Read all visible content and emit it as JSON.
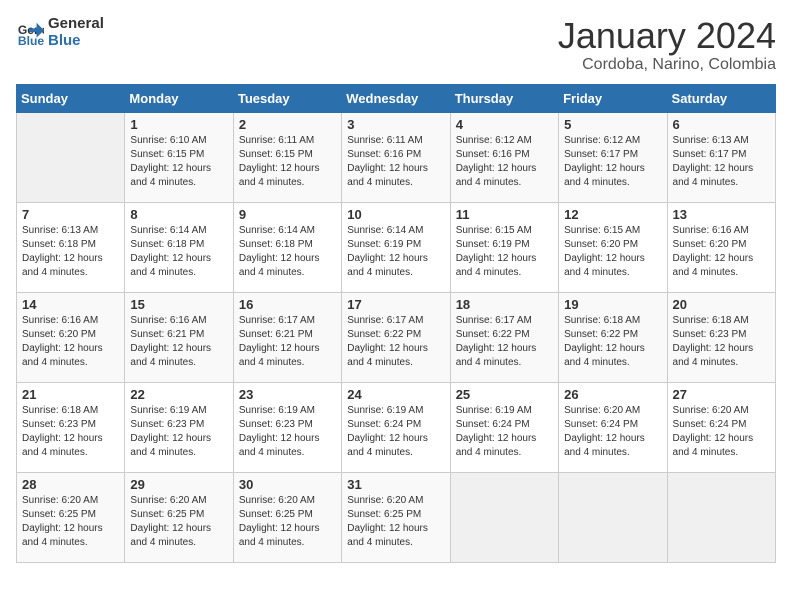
{
  "logo": {
    "line1": "General",
    "line2": "Blue"
  },
  "title": "January 2024",
  "subtitle": "Cordoba, Narino, Colombia",
  "days_header": [
    "Sunday",
    "Monday",
    "Tuesday",
    "Wednesday",
    "Thursday",
    "Friday",
    "Saturday"
  ],
  "weeks": [
    [
      {
        "day": "",
        "info": ""
      },
      {
        "day": "1",
        "info": "Sunrise: 6:10 AM\nSunset: 6:15 PM\nDaylight: 12 hours\nand 4 minutes."
      },
      {
        "day": "2",
        "info": "Sunrise: 6:11 AM\nSunset: 6:15 PM\nDaylight: 12 hours\nand 4 minutes."
      },
      {
        "day": "3",
        "info": "Sunrise: 6:11 AM\nSunset: 6:16 PM\nDaylight: 12 hours\nand 4 minutes."
      },
      {
        "day": "4",
        "info": "Sunrise: 6:12 AM\nSunset: 6:16 PM\nDaylight: 12 hours\nand 4 minutes."
      },
      {
        "day": "5",
        "info": "Sunrise: 6:12 AM\nSunset: 6:17 PM\nDaylight: 12 hours\nand 4 minutes."
      },
      {
        "day": "6",
        "info": "Sunrise: 6:13 AM\nSunset: 6:17 PM\nDaylight: 12 hours\nand 4 minutes."
      }
    ],
    [
      {
        "day": "7",
        "info": "Sunrise: 6:13 AM\nSunset: 6:18 PM\nDaylight: 12 hours\nand 4 minutes."
      },
      {
        "day": "8",
        "info": "Sunrise: 6:14 AM\nSunset: 6:18 PM\nDaylight: 12 hours\nand 4 minutes."
      },
      {
        "day": "9",
        "info": "Sunrise: 6:14 AM\nSunset: 6:18 PM\nDaylight: 12 hours\nand 4 minutes."
      },
      {
        "day": "10",
        "info": "Sunrise: 6:14 AM\nSunset: 6:19 PM\nDaylight: 12 hours\nand 4 minutes."
      },
      {
        "day": "11",
        "info": "Sunrise: 6:15 AM\nSunset: 6:19 PM\nDaylight: 12 hours\nand 4 minutes."
      },
      {
        "day": "12",
        "info": "Sunrise: 6:15 AM\nSunset: 6:20 PM\nDaylight: 12 hours\nand 4 minutes."
      },
      {
        "day": "13",
        "info": "Sunrise: 6:16 AM\nSunset: 6:20 PM\nDaylight: 12 hours\nand 4 minutes."
      }
    ],
    [
      {
        "day": "14",
        "info": "Sunrise: 6:16 AM\nSunset: 6:20 PM\nDaylight: 12 hours\nand 4 minutes."
      },
      {
        "day": "15",
        "info": "Sunrise: 6:16 AM\nSunset: 6:21 PM\nDaylight: 12 hours\nand 4 minutes."
      },
      {
        "day": "16",
        "info": "Sunrise: 6:17 AM\nSunset: 6:21 PM\nDaylight: 12 hours\nand 4 minutes."
      },
      {
        "day": "17",
        "info": "Sunrise: 6:17 AM\nSunset: 6:22 PM\nDaylight: 12 hours\nand 4 minutes."
      },
      {
        "day": "18",
        "info": "Sunrise: 6:17 AM\nSunset: 6:22 PM\nDaylight: 12 hours\nand 4 minutes."
      },
      {
        "day": "19",
        "info": "Sunrise: 6:18 AM\nSunset: 6:22 PM\nDaylight: 12 hours\nand 4 minutes."
      },
      {
        "day": "20",
        "info": "Sunrise: 6:18 AM\nSunset: 6:23 PM\nDaylight: 12 hours\nand 4 minutes."
      }
    ],
    [
      {
        "day": "21",
        "info": "Sunrise: 6:18 AM\nSunset: 6:23 PM\nDaylight: 12 hours\nand 4 minutes."
      },
      {
        "day": "22",
        "info": "Sunrise: 6:19 AM\nSunset: 6:23 PM\nDaylight: 12 hours\nand 4 minutes."
      },
      {
        "day": "23",
        "info": "Sunrise: 6:19 AM\nSunset: 6:23 PM\nDaylight: 12 hours\nand 4 minutes."
      },
      {
        "day": "24",
        "info": "Sunrise: 6:19 AM\nSunset: 6:24 PM\nDaylight: 12 hours\nand 4 minutes."
      },
      {
        "day": "25",
        "info": "Sunrise: 6:19 AM\nSunset: 6:24 PM\nDaylight: 12 hours\nand 4 minutes."
      },
      {
        "day": "26",
        "info": "Sunrise: 6:20 AM\nSunset: 6:24 PM\nDaylight: 12 hours\nand 4 minutes."
      },
      {
        "day": "27",
        "info": "Sunrise: 6:20 AM\nSunset: 6:24 PM\nDaylight: 12 hours\nand 4 minutes."
      }
    ],
    [
      {
        "day": "28",
        "info": "Sunrise: 6:20 AM\nSunset: 6:25 PM\nDaylight: 12 hours\nand 4 minutes."
      },
      {
        "day": "29",
        "info": "Sunrise: 6:20 AM\nSunset: 6:25 PM\nDaylight: 12 hours\nand 4 minutes."
      },
      {
        "day": "30",
        "info": "Sunrise: 6:20 AM\nSunset: 6:25 PM\nDaylight: 12 hours\nand 4 minutes."
      },
      {
        "day": "31",
        "info": "Sunrise: 6:20 AM\nSunset: 6:25 PM\nDaylight: 12 hours\nand 4 minutes."
      },
      {
        "day": "",
        "info": ""
      },
      {
        "day": "",
        "info": ""
      },
      {
        "day": "",
        "info": ""
      }
    ]
  ]
}
